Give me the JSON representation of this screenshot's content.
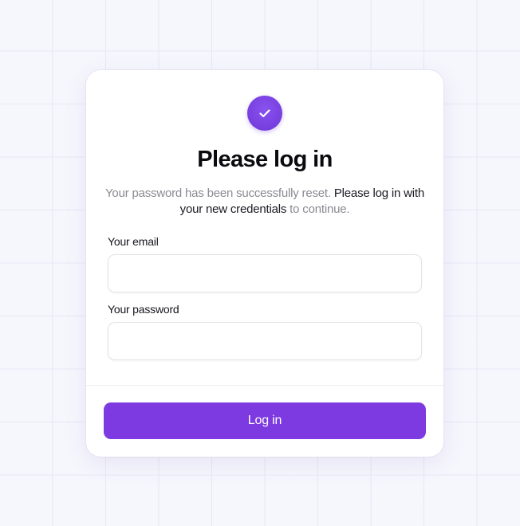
{
  "card": {
    "title": "Please log in",
    "subtitle_muted_1": "Your password has been successfully reset. ",
    "subtitle_strong": "Please log in with your new credentials",
    "subtitle_muted_2": " to continue."
  },
  "form": {
    "email_label": "Your email",
    "email_value": "",
    "password_label": "Your password",
    "password_value": "",
    "submit_label": "Log in"
  },
  "icons": {
    "badge": "check-icon"
  },
  "colors": {
    "accent": "#7c3ae0",
    "badge": "#7b45e6",
    "background": "#f6f6fd"
  }
}
